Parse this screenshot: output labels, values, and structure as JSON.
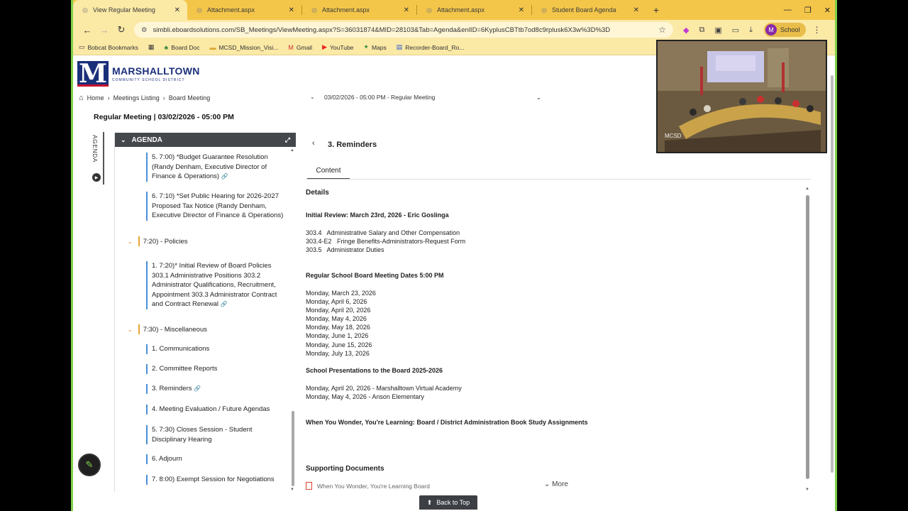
{
  "browser": {
    "tabs": [
      {
        "title": "View Regular Meeting",
        "active": true
      },
      {
        "title": "Attachment.aspx",
        "active": false
      },
      {
        "title": "Attachment.aspx",
        "active": false
      },
      {
        "title": "Attachment.aspx",
        "active": false
      },
      {
        "title": "Student Board Agenda",
        "active": false
      }
    ],
    "url": "simbli.eboardsolutions.com/SB_Meetings/ViewMeeting.aspx?S=36031874&MID=28103&Tab=Agenda&enlID=6KyplusCBTtb7od8c9rplusk6X3w%3D%3D",
    "profile_label": "School",
    "profile_initial": "M",
    "bookmarks": [
      "Bobcat Bookmarks",
      "Board Doc",
      "MCSD_Mission_Visi...",
      "Gmail",
      "YouTube",
      "Maps",
      "Recorder-Board_Ro..."
    ]
  },
  "site": {
    "logo_letter": "M",
    "logo_name": "MARSHALLTOWN",
    "logo_sub": "COMMUNITY SCHOOL DISTRICT",
    "breadcrumb": [
      "Home",
      "Meetings Listing",
      "Board Meeting"
    ],
    "meeting_select": "03/02/2026 - 05:00 PM - Regular Meeting",
    "meeting_title": "Regular Meeting | 03/02/2026 - 05:00 PM"
  },
  "agenda": {
    "side_label": "AGENDA",
    "header": "AGENDA",
    "items": [
      {
        "text": "5. 7:00) *Budget Guarantee Resolution (Randy Denham, Executive Director of Finance & Operations)",
        "attach": true
      },
      {
        "text": "6. 7:10) *Set Public Hearing for 2026-2027 Proposed Tax Notice (Randy Denham, Executive Director of Finance & Operations)",
        "attach": false
      },
      {
        "text": "1. 7:20)* Initial Review of Board Policies 303.1 Administrative Positions 303.2 Administrator Qualifications, Recruitment, Appointment 303.3 Administrator Contract and Contract Renewal",
        "attach": true
      },
      {
        "text": "1. Communications",
        "attach": false
      },
      {
        "text": "2. Committee Reports",
        "attach": false
      },
      {
        "text": "3. Reminders",
        "attach": true
      },
      {
        "text": "4. Meeting Evaluation / Future Agendas",
        "attach": false
      },
      {
        "text": "5. 7:30) Closes Session - Student Disciplinary Hearing",
        "attach": false
      },
      {
        "text": "6. Adjourn",
        "attach": false
      },
      {
        "text": "7. 8:00) Exempt Session for Negotiations",
        "attach": false
      }
    ],
    "sections": [
      "7:20) - Policies",
      "7:30) - Miscellaneous"
    ]
  },
  "item": {
    "title": "3. Reminders",
    "tab": "Content",
    "details_label": "Details",
    "review_heading": "Initial Review: March 23rd, 2026 - Eric Goslinga",
    "policies": [
      "303.4   Administrative Salary and Other Compensation",
      "303.4-E2   Fringe Benefits-Administrators-Request Form",
      "303.5   Administrator Duties"
    ],
    "dates_heading": "Regular School Board Meeting Dates 5:00 PM",
    "dates": [
      "Monday, March 23, 2026",
      "Monday, April 6, 2026",
      "Monday, April 20, 2026",
      "Monday, May 4, 2026",
      "Monday, May 18, 2026",
      "Monday, June 1, 2026",
      "Monday, June 15, 2026",
      "Monday, July 13, 2026"
    ],
    "presentations_heading": "School Presentations to the Board 2025-2026",
    "presentations": [
      "Monday, April 20, 2026 - Marshalltown Virtual Academy",
      "Monday, May 4, 2026 - Anson Elementary"
    ],
    "book_heading": "When You Wonder, You're Learning: Board / District Administration Book Study Assignments",
    "supporting_heading": "Supporting Documents",
    "document": "When You Wonder, You're Learning Board",
    "more_label": "More",
    "back_to_top": "Back to Top"
  },
  "video": {
    "label": "MCSD"
  }
}
